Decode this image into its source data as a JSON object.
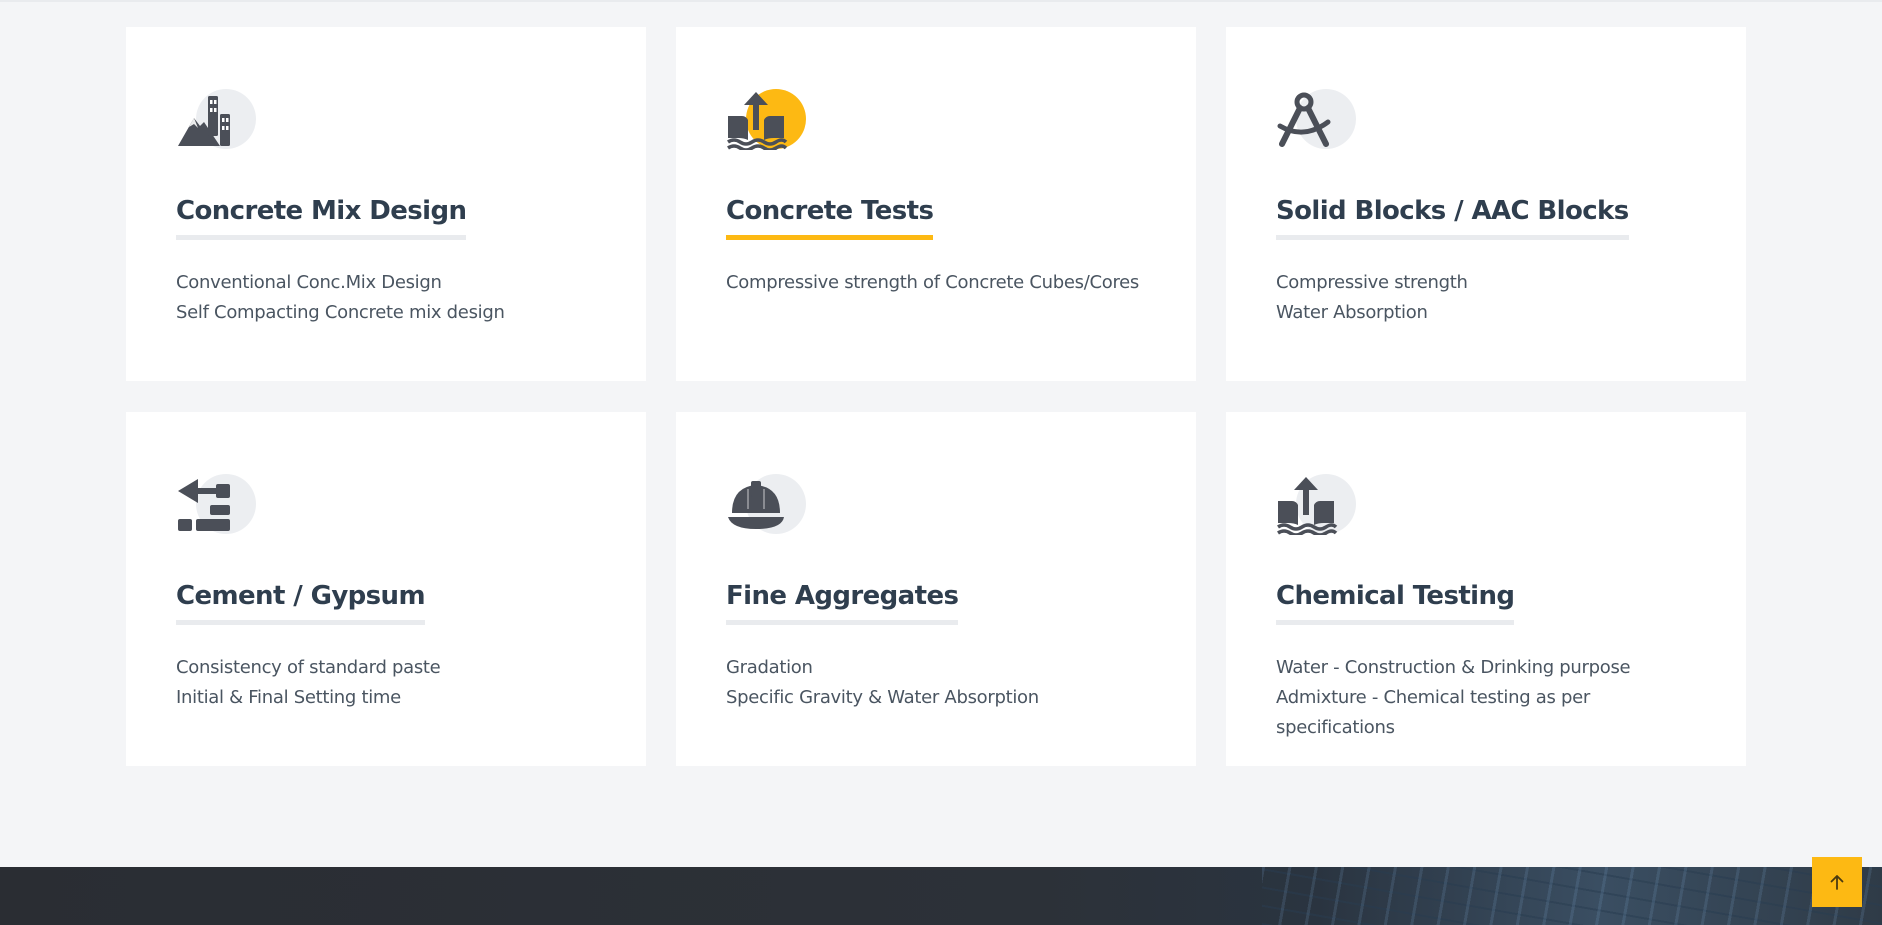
{
  "colors": {
    "accent": "#fdb913",
    "title": "#2f3e4e",
    "text": "#4a5561",
    "icon": "#4b4f58",
    "background": "#f4f5f7"
  },
  "services": [
    {
      "icon": "mountain-city-icon",
      "title": "Concrete Mix Design",
      "lines": [
        "Conventional Conc.Mix Design",
        "Self Compacting Concrete mix design"
      ]
    },
    {
      "icon": "flood-upload-icon",
      "title": "Concrete Tests",
      "lines": [
        "Compressive strength of Concrete Cubes/Cores"
      ]
    },
    {
      "icon": "compass-drafting-icon",
      "title": "Solid Blocks / AAC Blocks",
      "lines": [
        "Compressive strength",
        "Water Absorption"
      ]
    },
    {
      "icon": "trowel-bricks-icon",
      "title": "Cement / Gypsum",
      "lines": [
        "Consistency of standard paste",
        "Initial & Final Setting time"
      ]
    },
    {
      "icon": "helmet-icon",
      "title": "Fine Aggregates",
      "lines": [
        "Gradation",
        "Specific Gravity & Water Absorption"
      ]
    },
    {
      "icon": "flood-upload-icon",
      "title": "Chemical Testing",
      "lines": [
        "Water - Construction & Drinking purpose",
        "Admixture - Chemical testing as per specifications"
      ]
    }
  ],
  "scroll_top": {
    "icon": "arrow-up-icon"
  }
}
